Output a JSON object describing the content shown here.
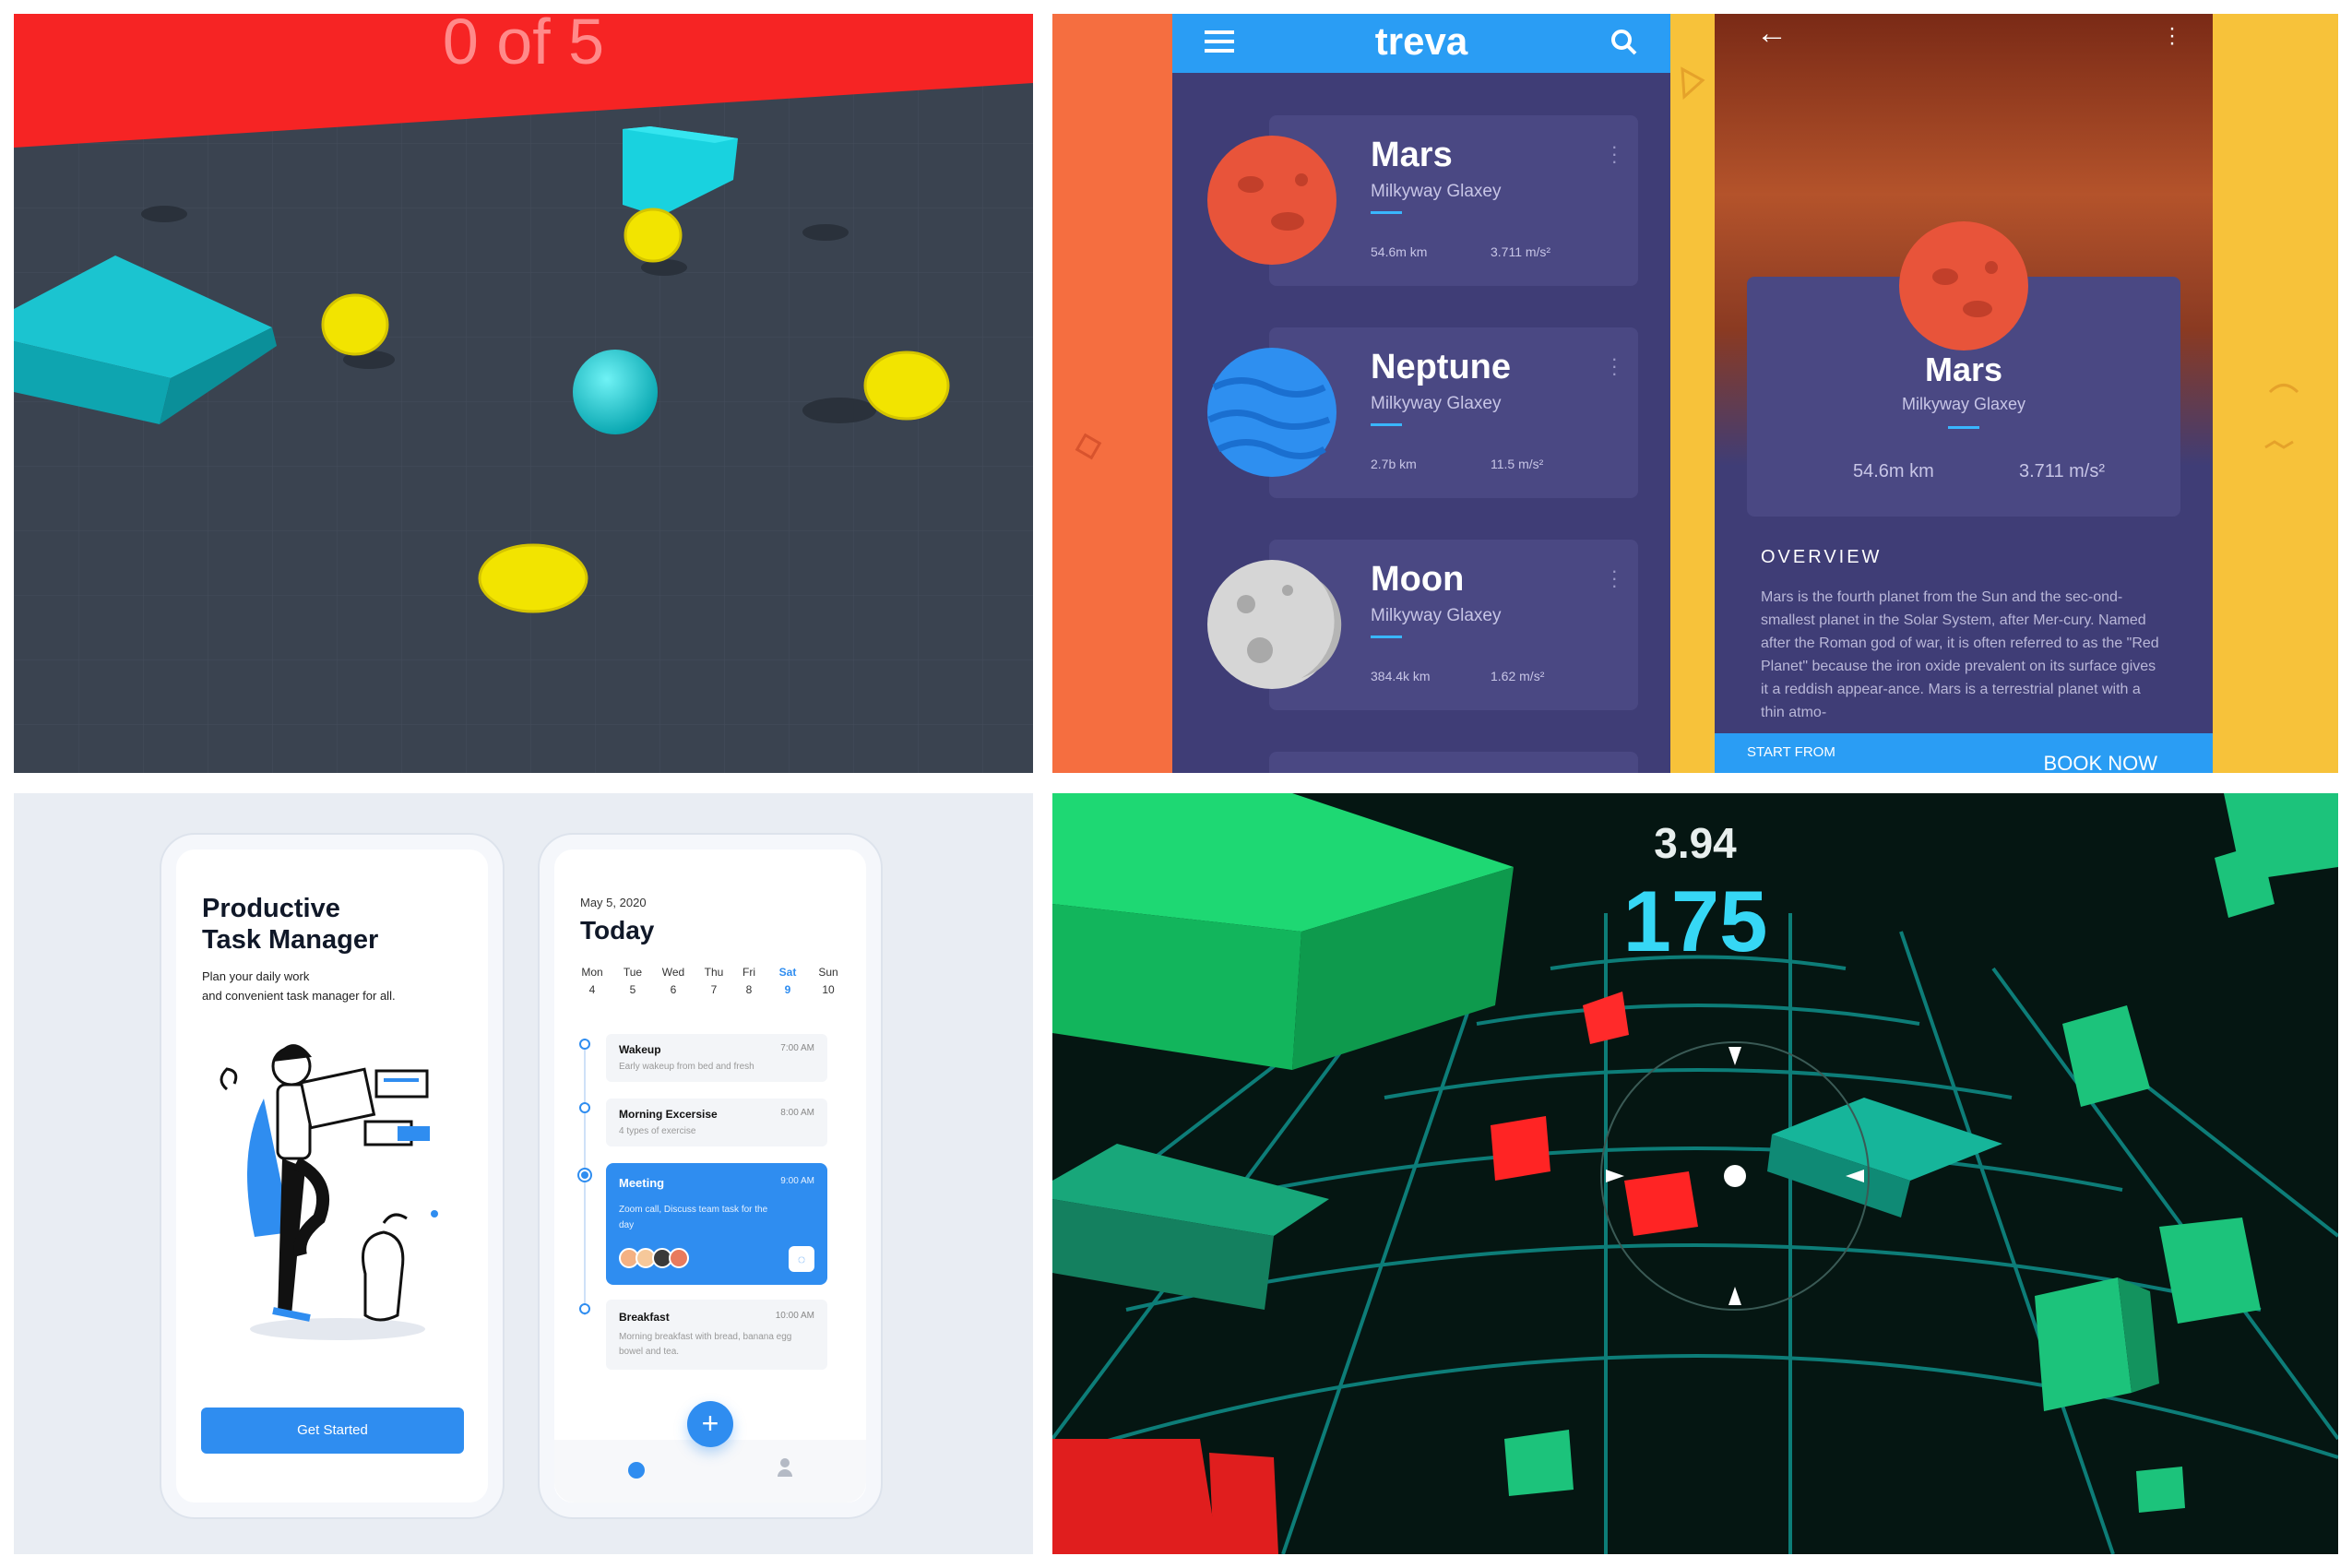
{
  "game1": {
    "counter": "0 of 5"
  },
  "treva": {
    "app_title": "treva",
    "planets": [
      {
        "name": "Mars",
        "galaxy": "Milkyway Glaxey",
        "distance": "54.6m km",
        "gravity": "3.711 m/s²",
        "color": "#e8543a"
      },
      {
        "name": "Neptune",
        "galaxy": "Milkyway Glaxey",
        "distance": "2.7b km",
        "gravity": "11.5 m/s²",
        "color": "#2e8ff0"
      },
      {
        "name": "Moon",
        "galaxy": "Milkyway Glaxey",
        "distance": "384.4k km",
        "gravity": "1.62 m/s²",
        "color": "#d6d6d6"
      }
    ],
    "detail": {
      "name": "Mars",
      "galaxy": "Milkyway Glaxey",
      "distance": "54.6m km",
      "gravity": "3.711 m/s²",
      "overview_heading": "OVERVIEW",
      "overview_text": "Mars is the fourth planet from the Sun and the sec-ond-smallest planet in the Solar System, after Mer-cury. Named after the Roman god of war, it is often referred to as the \"Red Planet\" because the iron oxide prevalent on its surface gives it a reddish appear-ance. Mars is a terrestrial planet with a thin atmo-",
      "start_from": "START FROM",
      "book_now": "BOOK NOW"
    }
  },
  "task": {
    "onboarding": {
      "title_line1": "Productive",
      "title_line2": "Task Manager",
      "subtitle_line1": "Plan your daily work",
      "subtitle_line2": "and convenient task manager for all.",
      "cta": "Get Started"
    },
    "today": {
      "date": "May 5, 2020",
      "heading": "Today",
      "days": [
        {
          "name": "Mon",
          "num": "4"
        },
        {
          "name": "Tue",
          "num": "5"
        },
        {
          "name": "Wed",
          "num": "6"
        },
        {
          "name": "Thu",
          "num": "7"
        },
        {
          "name": "Fri",
          "num": "8"
        },
        {
          "name": "Sat",
          "num": "9"
        },
        {
          "name": "Sun",
          "num": "10"
        }
      ],
      "tasks": [
        {
          "title": "Wakeup",
          "time": "7:00 AM",
          "desc": "Early wakeup from bed and fresh"
        },
        {
          "title": "Morning Excersise",
          "time": "8:00 AM",
          "desc": "4 types of exercise"
        },
        {
          "title": "Meeting",
          "time": "9:00 AM",
          "desc": "Zoom call, Discuss team task for the day"
        },
        {
          "title": "Breakfast",
          "time": "10:00 AM",
          "desc": "Morning breakfast with bread, banana egg bowel and tea."
        }
      ]
    }
  },
  "game2": {
    "time": "3.94",
    "score": "175"
  }
}
